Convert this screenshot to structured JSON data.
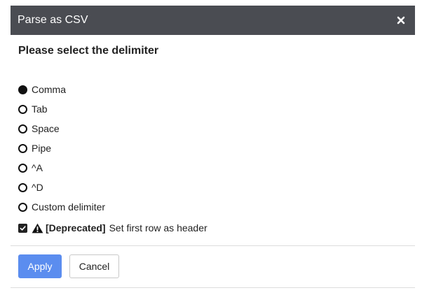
{
  "dialog": {
    "title": "Parse as CSV",
    "close_icon": "close-icon",
    "heading": "Please select the delimiter"
  },
  "delimiter": {
    "selected": "Comma",
    "options": [
      {
        "label": "Comma",
        "selected": true
      },
      {
        "label": "Tab",
        "selected": false
      },
      {
        "label": "Space",
        "selected": false
      },
      {
        "label": "Pipe",
        "selected": false
      },
      {
        "label": "^A",
        "selected": false
      },
      {
        "label": "^D",
        "selected": false
      },
      {
        "label": "Custom delimiter",
        "selected": false
      }
    ]
  },
  "header_option": {
    "checked": true,
    "warning_icon": "warning-icon",
    "tag": "[Deprecated]",
    "label": "Set first row as header"
  },
  "buttons": {
    "apply_label": "Apply",
    "cancel_label": "Cancel"
  },
  "colors": {
    "titlebar": "#4a4c52",
    "primary": "#5b8def"
  }
}
